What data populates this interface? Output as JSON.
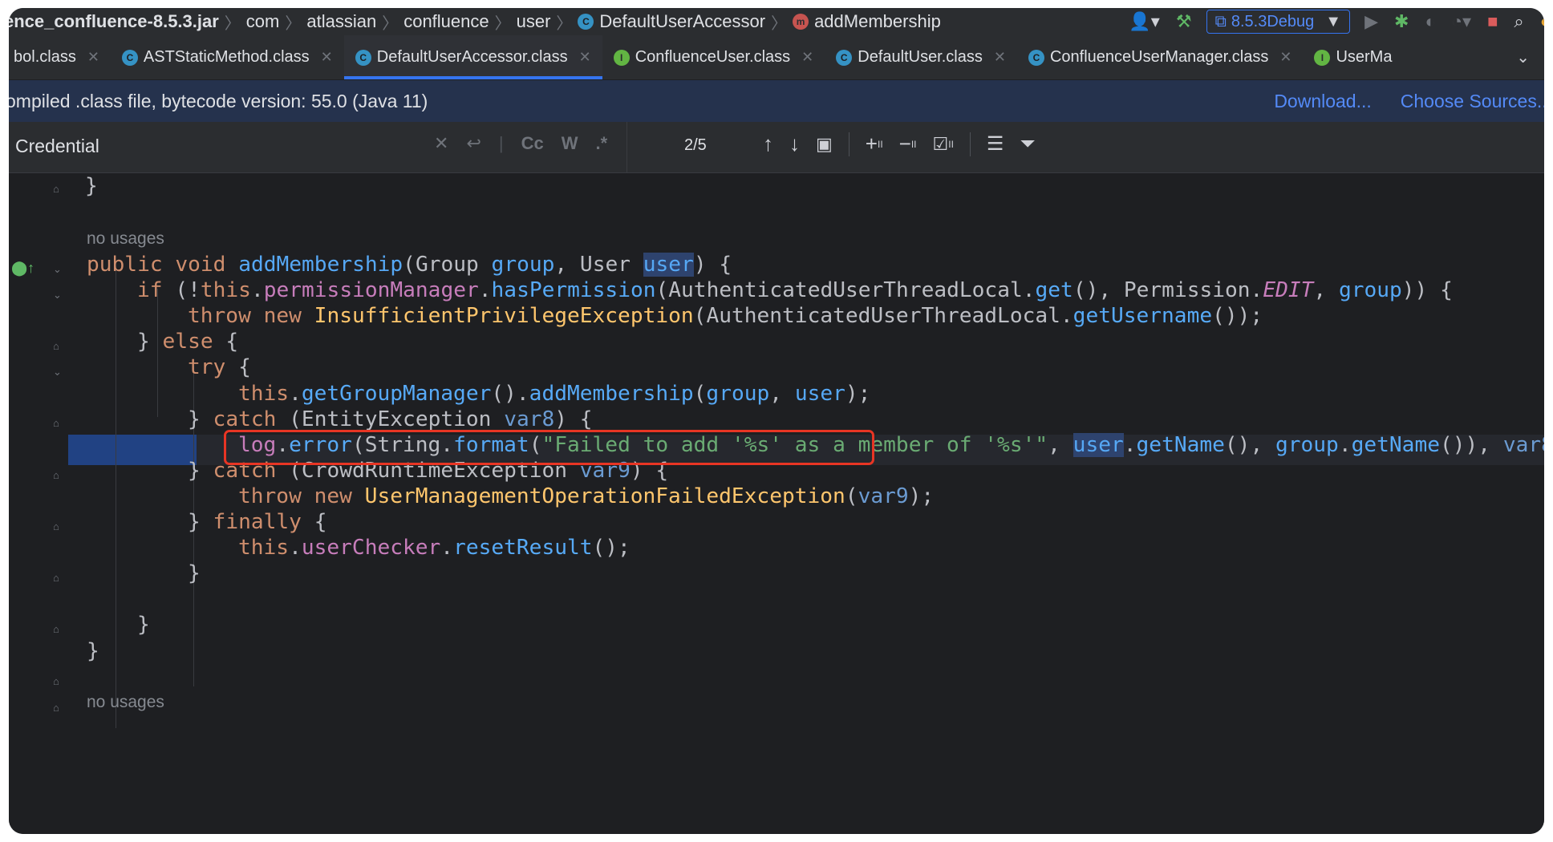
{
  "breadcrumbs": {
    "items": [
      "ence_confluence-8.5.3.jar",
      "com",
      "atlassian",
      "confluence",
      "user",
      "DefaultUserAccessor",
      "addMembership"
    ]
  },
  "toolbar": {
    "run_config": "8.5.3Debug",
    "icons": [
      "user-dropdown-icon",
      "build-hammer-icon",
      "run-icon",
      "debug-icon",
      "coverage-icon",
      "profile-icon",
      "stop-icon",
      "search-icon",
      "update-icon"
    ]
  },
  "tabs": [
    {
      "label": "bol.class",
      "kind": "class",
      "active": false
    },
    {
      "label": "ASTStaticMethod.class",
      "kind": "class",
      "active": false
    },
    {
      "label": "DefaultUserAccessor.class",
      "kind": "class",
      "active": true
    },
    {
      "label": "ConfluenceUser.class",
      "kind": "interface",
      "active": false
    },
    {
      "label": "DefaultUser.class",
      "kind": "class",
      "active": false
    },
    {
      "label": "ConfluenceUserManager.class",
      "kind": "class",
      "active": false
    },
    {
      "label": "UserMa",
      "kind": "interface",
      "active": false
    }
  ],
  "notice": {
    "text": "ompiled .class file, bytecode version: 55.0 (Java 11)",
    "download": "Download...",
    "choose_sources": "Choose Sources..."
  },
  "search": {
    "value": "Credential",
    "match_count": "2/5",
    "opt_case": "Cc",
    "opt_words": "W",
    "opt_regex": ".*"
  },
  "code": {
    "hint_top": "no usages",
    "hint_bottom": "no usages",
    "method_name": "addMembership",
    "log_message": "\"Failed to add '%s' as a member of '%s'\""
  },
  "colors": {
    "background": "#1e1f22",
    "keyword": "#cf8e6d",
    "field": "#c77dbb",
    "method": "#56a8f5",
    "string": "#6aab73",
    "accent": "#3574f0",
    "highlight_box": "#e83524"
  }
}
